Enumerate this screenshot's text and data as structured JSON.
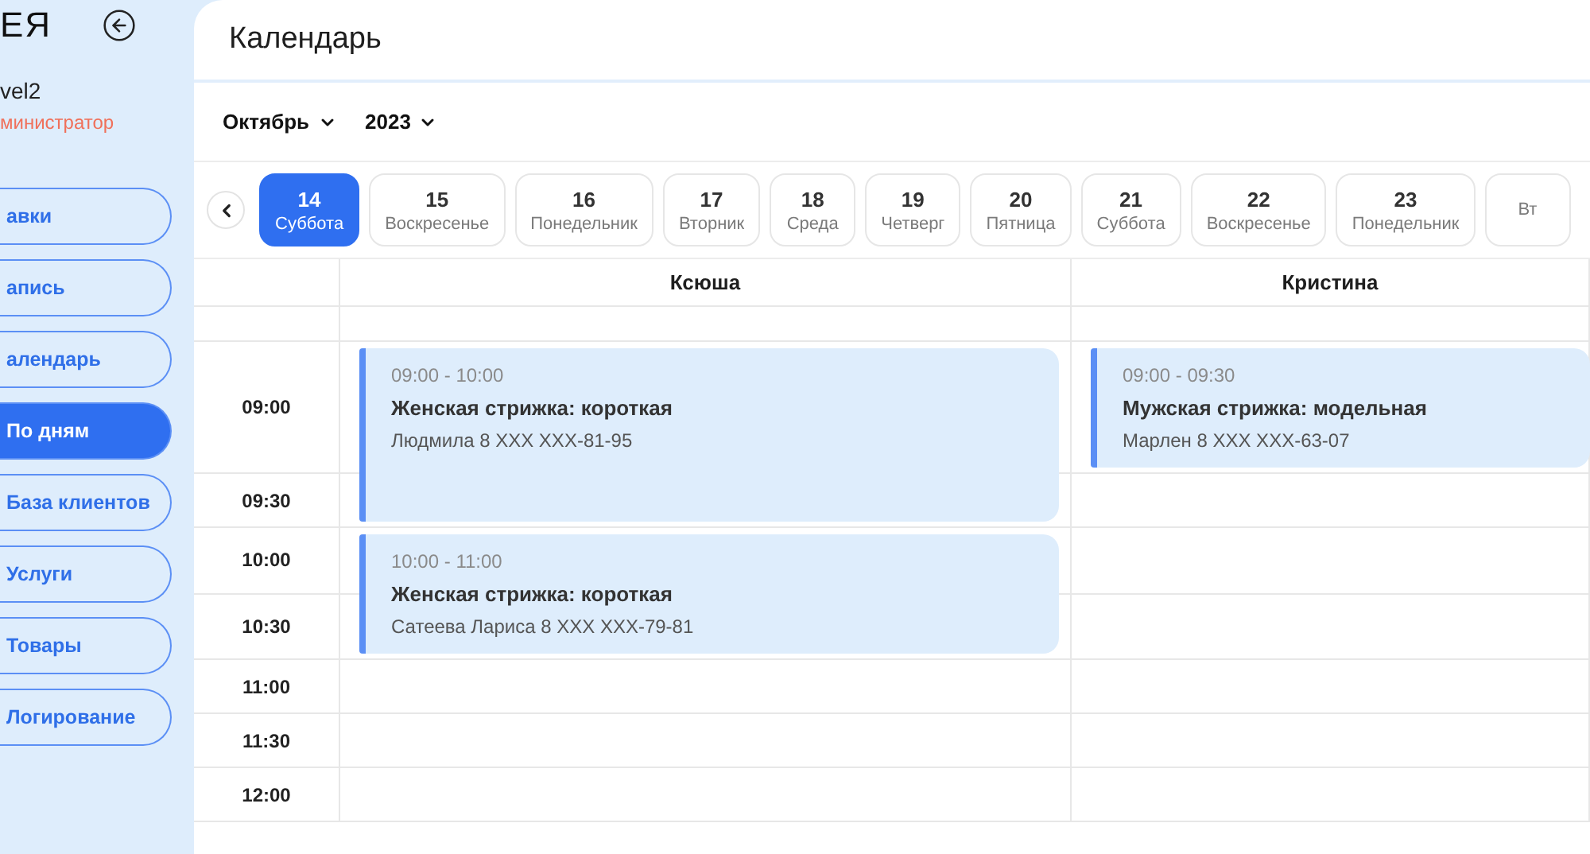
{
  "sidebar": {
    "logo": "ЕЯ",
    "user": {
      "name": "vel2",
      "role": "министратор"
    },
    "items": [
      {
        "label": "авки",
        "selected": false
      },
      {
        "label": "апись",
        "selected": false
      },
      {
        "label": "алендарь",
        "selected": false
      },
      {
        "label": "По дням",
        "selected": true
      },
      {
        "label": "База клиентов",
        "selected": false
      },
      {
        "label": "Услуги",
        "selected": false
      },
      {
        "label": "Товары",
        "selected": false
      },
      {
        "label": "Логирование",
        "selected": false
      }
    ]
  },
  "header": {
    "title": "Календарь"
  },
  "filters": {
    "month": "Октябрь",
    "year": "2023"
  },
  "date_strip": {
    "days": [
      {
        "day": "14",
        "weekday": "Суббота",
        "selected": true
      },
      {
        "day": "15",
        "weekday": "Воскресенье",
        "selected": false
      },
      {
        "day": "16",
        "weekday": "Понедельник",
        "selected": false
      },
      {
        "day": "17",
        "weekday": "Вторник",
        "selected": false
      },
      {
        "day": "18",
        "weekday": "Среда",
        "selected": false
      },
      {
        "day": "19",
        "weekday": "Четверг",
        "selected": false
      },
      {
        "day": "20",
        "weekday": "Пятница",
        "selected": false
      },
      {
        "day": "21",
        "weekday": "Суббота",
        "selected": false
      },
      {
        "day": "22",
        "weekday": "Воскресенье",
        "selected": false
      },
      {
        "day": "23",
        "weekday": "Понедельник",
        "selected": false
      },
      {
        "weekday": "Вт",
        "selected": false
      }
    ]
  },
  "schedule": {
    "times": [
      "09:00",
      "09:30",
      "10:00",
      "10:30",
      "11:00",
      "11:30",
      "12:00"
    ],
    "staff": [
      {
        "name": "Ксюша",
        "slots": [
          {
            "kind": "appointment",
            "time": "09:00 - 10:00",
            "service": "Женская стрижка: короткая",
            "client": "Людмила 8 XXX XXX-81-95"
          },
          {
            "kind": "continued"
          },
          {
            "kind": "appointment",
            "time": "10:00 - 11:00",
            "service": "Женская стрижка: короткая",
            "client": "Сатеева Лариса 8 XXX XXX-79-81"
          },
          {
            "kind": "continued"
          },
          {
            "kind": "free"
          },
          {
            "kind": "free"
          },
          {
            "kind": "free"
          }
        ]
      },
      {
        "name": "Кристина",
        "slots": [
          {
            "kind": "appointment",
            "time": "09:00 - 09:30",
            "service": "Мужская стрижка: модельная",
            "client": "Марлен 8 XXX XXX-63-07"
          },
          {
            "kind": "free"
          },
          {
            "kind": "free"
          },
          {
            "kind": "free"
          },
          {
            "kind": "free"
          },
          {
            "kind": "free"
          },
          {
            "kind": "free"
          }
        ]
      }
    ]
  }
}
